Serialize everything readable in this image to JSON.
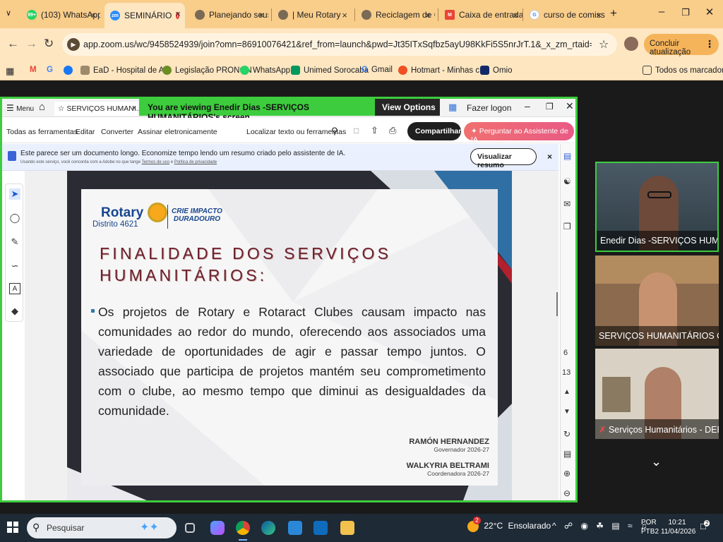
{
  "browser": {
    "tabs": [
      {
        "label": "(103) WhatsApp",
        "badge": "99+"
      },
      {
        "label": "SEMINÁRIO",
        "badge": "zm"
      },
      {
        "label": "Planejando seus"
      },
      {
        "label": "| Meu Rotary"
      },
      {
        "label": "Reciclagem de C"
      },
      {
        "label": "Caixa de entrada"
      },
      {
        "label": "curso de comiss"
      }
    ],
    "new_tab": "+",
    "url": "app.zoom.us/wc/9458524939/join?omn=86910076421&ref_from=launch&pwd=Jt35ITxSqfbz5ayU98KkFi5S5nrJrT.1&_x_zm_rtaid=doENimDTS5GyEy-8rLTT...",
    "update_label": "Concluir atualização",
    "bookmarks": [
      "EaD - Hospital de A...",
      "Legislação PRONON",
      "WhatsApp",
      "Unimed Sorocaba",
      "Gmail",
      "Hotmart - Minhas c...",
      "Omio"
    ],
    "all_bookmarks": "Todos os marcadores"
  },
  "zoom": {
    "menu_label": "Menu",
    "doc_tab": "SERVIÇOS HUMANI...",
    "viewing_banner": "You are viewing  Enedir Dias -SERVIÇOS HUMANITÁRIOS's screen",
    "view_options": "View Options",
    "logon": "Fazer logon"
  },
  "acrobat": {
    "tools": [
      "Todas as ferramentas",
      "Editar",
      "Converter",
      "Assinar eletronicamente"
    ],
    "find": "Localizar texto ou ferramentas",
    "share": "Compartilhar",
    "ask_ai": "Perguntar ao Assistente de IA",
    "notice": "Este parece ser um documento longo. Economize tempo lendo um resumo criado pelo assistente de IA.",
    "notice_small_1": "Usando este serviço, você concorda com a Adobe no que tange",
    "notice_link_1": "Termos de uso",
    "notice_and": "e",
    "notice_link_2": "Política de privacidade",
    "summary_btn": "Visualizar resumo",
    "page_current": "6",
    "page_total": "13"
  },
  "slide": {
    "logo_rotary": "Rotary",
    "logo_district": "Distrito 4621",
    "logo_tagline_1": "CRIE IMPACTO",
    "logo_tagline_2": "DURADOURO",
    "title_1": "FINALIDADE DOS SERVIÇOS",
    "title_2": "HUMANITÁRIOS:",
    "body": "Os projetos de Rotary e Rotaract Clubes causam impacto nas comunidades ao redor do mundo, oferecendo aos associados uma variedade de oportunidades de agir e passar tempo juntos. O associado que participa de projetos mantém seu comprometimento com o clube, ao mesmo tempo que diminui as desigualdades da comunidade.",
    "sig1_name": "RAMÓN HERNANDEZ",
    "sig1_role": "Governador  2026-27",
    "sig2_name": "WALKYRIA BELTRAMI",
    "sig2_role": "Coordenadora  2026-27"
  },
  "participants": [
    {
      "name": "Enedir Dias -SERVIÇOS HUMA..."
    },
    {
      "name": "SERVIÇOS HUMANITÁRIOS Cla..."
    },
    {
      "name": "Serviços Humanitários - DEB..."
    }
  ],
  "taskbar": {
    "search": "Pesquisar",
    "weather_temp": "22°C",
    "weather_text": "Ensolarado",
    "weather_badge": "2",
    "lang_1": "POR",
    "lang_2": "PTB2",
    "time": "10:21",
    "date": "11/04/2026",
    "notif": "2"
  },
  "colors": {
    "tab_bg": "#f9cd8a",
    "zoom_green": "#3dcc3d",
    "slide_title": "#6b1f2a",
    "taskbar": "#1e2a36"
  }
}
